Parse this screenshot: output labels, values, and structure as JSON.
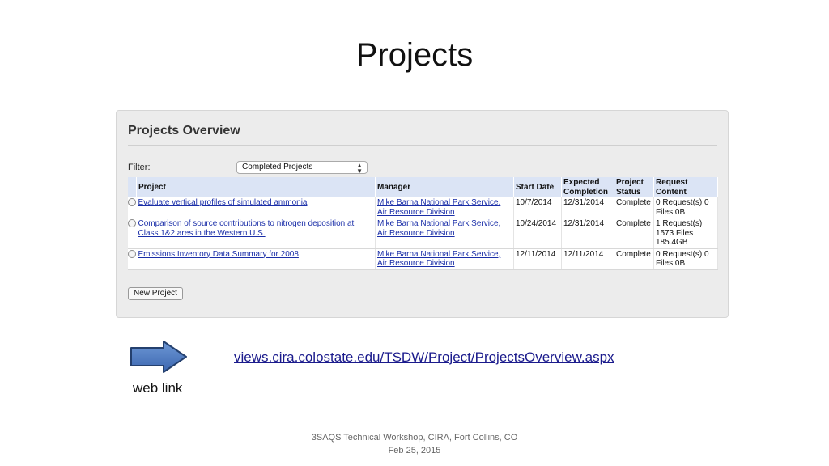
{
  "slide": {
    "title": "Projects",
    "footer_line1": "3SAQS Technical Workshop,  CIRA, Fort Collins, CO",
    "footer_line2": "Feb 25, 2015"
  },
  "panel": {
    "heading": "Projects Overview",
    "filter_label": "Filter:",
    "filter_value": "Completed Projects",
    "new_project_label": "New Project"
  },
  "table": {
    "headers": [
      "Project",
      "Manager",
      "Start Date",
      "Expected Completion",
      "Project Status",
      "Request Content"
    ],
    "rows": [
      {
        "project": "Evaluate vertical profiles of simulated ammonia",
        "manager": "Mike Barna National Park Service, Air Resource Division",
        "start_date": "10/7/2014",
        "expected_completion": "12/31/2014",
        "status": "Complete",
        "request_content": "0 Request(s) 0 Files 0B"
      },
      {
        "project": "Comparison of source contributions to nitrogen deposition at Class 1&2 ares in the Western U.S.",
        "manager": "Mike Barna National Park Service, Air Resource Division",
        "start_date": "10/24/2014",
        "expected_completion": "12/31/2014",
        "status": "Complete",
        "request_content": "1 Request(s) 1573 Files 185.4GB"
      },
      {
        "project": "Emissions Inventory Data Summary for 2008",
        "manager": "Mike Barna National Park Service, Air Resource Division",
        "start_date": "12/11/2014",
        "expected_completion": "12/11/2014",
        "status": "Complete",
        "request_content": "0 Request(s) 0 Files 0B"
      }
    ]
  },
  "web_link": {
    "caption": "web link",
    "url_text": "views.cira.colostate.edu/TSDW/Project/ProjectsOverview.aspx",
    "arrow_icon": "right-arrow-icon"
  },
  "colors": {
    "header_bg": "#dbe4f5",
    "link": "#1a2ea8",
    "arrow_fill": "#4a78c0"
  }
}
